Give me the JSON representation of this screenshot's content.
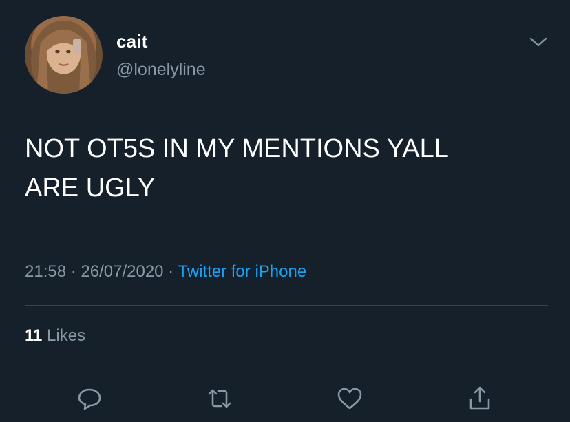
{
  "user": {
    "display_name": "cait",
    "handle": "@lonelyline"
  },
  "tweet": {
    "text_line1": "NOT OT5S IN MY MENTIONS YALL",
    "text_line2": "ARE UGLY",
    "time": "21:58",
    "dot1": " · ",
    "date": "26/07/2020",
    "dot2": " · ",
    "source": "Twitter for iPhone"
  },
  "stats": {
    "likes_count": "11",
    "likes_label": "Likes"
  },
  "icons": {
    "chevron": "chevron-down-icon",
    "reply": "reply-icon",
    "retweet": "retweet-icon",
    "like": "heart-icon",
    "share": "share-icon"
  },
  "colors": {
    "background": "#15202b",
    "link": "#1da1f2",
    "secondary_text": "#8899a6",
    "divider": "#38444d"
  }
}
